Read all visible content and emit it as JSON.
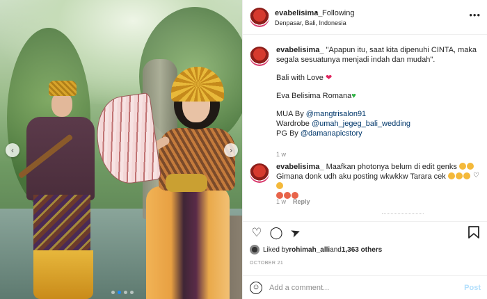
{
  "post": {
    "username": "evabelisima_",
    "separator": "•",
    "follow_status": "Following",
    "location": "Denpasar, Bali, Indonesia",
    "more_icon": "more-horizontal-icon"
  },
  "carousel": {
    "prev_icon": "‹",
    "next_icon": "›",
    "dots": 4,
    "active_dot": 1
  },
  "caption": {
    "username": "evabelisima_",
    "line1": "\"Apapun itu, saat kita dipenuhi CINTA, maka segala sesuatunya menjadi indah dan mudah\".",
    "line2": "Bali with Love",
    "line3": "Eva Belisima Romana",
    "mua_label": "MUA By ",
    "mua_mention": "@mangtrisalon91",
    "wardrobe_label": "Wardrobe ",
    "wardrobe_mention": "@umah_jegeg_bali_wedding",
    "pg_label": "PG By ",
    "pg_mention": "@damanapicstory",
    "time": "1 w"
  },
  "comment1": {
    "username": "evabelisima_",
    "text": "Maafkan photonya belum di edit genks",
    "text2": "Gimana donk udh aku posting wkwkkw Tarara cek",
    "time": "1 w",
    "reply_label": "Reply"
  },
  "actions": {
    "like_icon": "♡",
    "comment_icon": "◯",
    "share_icon": "➤",
    "save_icon": "⌑"
  },
  "likes": {
    "prefix": "Liked by ",
    "user": "rohimah_alli",
    "and": " and ",
    "others": "1,363 others"
  },
  "date": "OCTOBER 21",
  "add_comment": {
    "placeholder": "Add a comment...",
    "post_label": "Post"
  },
  "colors": {
    "mention": "#00376b",
    "post_button": "#b2dffc",
    "active_dot": "#1a8cff"
  }
}
